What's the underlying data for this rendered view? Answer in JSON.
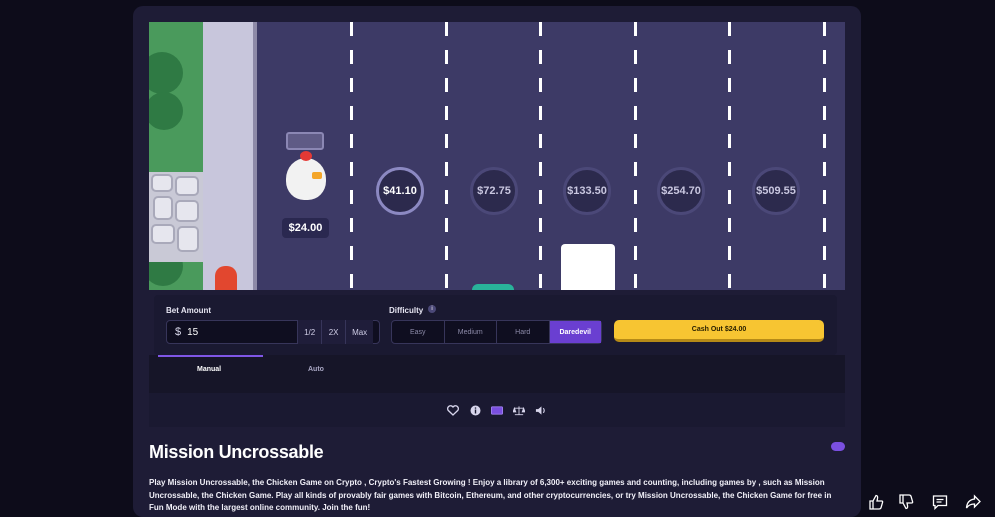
{
  "game": {
    "chicken_value": "$24.00",
    "lanes": [
      "$41.10",
      "$72.75",
      "$133.50",
      "$254.70",
      "$509.55"
    ]
  },
  "controls": {
    "bet_label": "Bet Amount",
    "currency": "$",
    "bet_value": "15",
    "half": "1/2",
    "double": "2X",
    "max": "Max",
    "difficulty_label": "Difficulty",
    "difficulty_options": [
      "Easy",
      "Medium",
      "Hard",
      "Daredevil"
    ],
    "difficulty_selected": "Daredevil",
    "cashout": "Cash Out $24.00"
  },
  "modes": {
    "manual": "Manual",
    "auto": "Auto"
  },
  "footer_icons": [
    "heart-icon",
    "info-icon",
    "theater-icon",
    "scale-icon",
    "speaker-icon"
  ],
  "page": {
    "title": "Mission Uncrossable",
    "description": "Play Mission Uncrossable, the Chicken Game on Crypto , Crypto's Fastest Growing ! Enjoy a library of 6,300+ exciting games and counting, including games by , such as Mission Uncrossable, the Chicken Game. Play all kinds of provably fair games with Bitcoin, Ethereum, and other cryptocurrencies, or try Mission Uncrossable, the Chicken Game for free in Fun Mode with the largest online community. Join the fun!"
  },
  "colors": {
    "accent": "#6a3fd1",
    "cashout": "#f7c532",
    "road": "#3d3a66"
  }
}
